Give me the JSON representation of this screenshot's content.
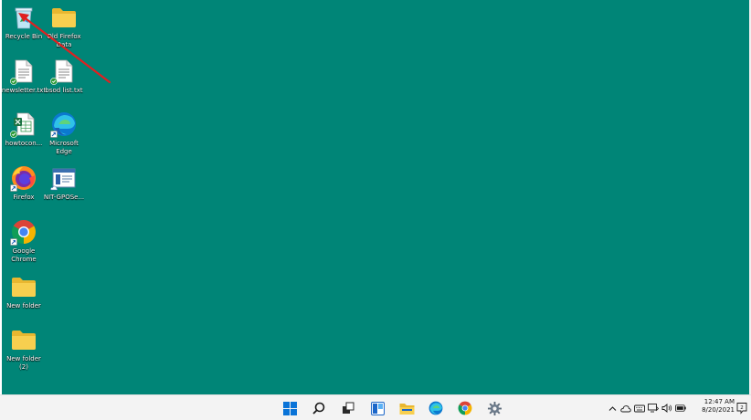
{
  "desktop": {
    "background_color": "#008577",
    "icons": [
      {
        "name": "recycle-bin",
        "label": "Recycle Bin",
        "icon": "recycle-bin-icon"
      },
      {
        "name": "old-firefox-data",
        "label": "Old Firefox\nData",
        "icon": "folder-icon"
      },
      {
        "name": "newsletter-txt",
        "label": "newsletter.txt",
        "icon": "text-file-icon"
      },
      {
        "name": "bsod-list-txt",
        "label": "bsod list.txt",
        "icon": "text-file-icon"
      },
      {
        "name": "howtocon",
        "label": "howtocon...",
        "icon": "spreadsheet-file-icon"
      },
      {
        "name": "microsoft-edge",
        "label": "Microsoft\nEdge",
        "icon": "edge-icon"
      },
      {
        "name": "firefox",
        "label": "Firefox",
        "icon": "firefox-icon"
      },
      {
        "name": "nit-gposet",
        "label": "NIT-GPOSe...",
        "icon": "app-window-icon"
      },
      {
        "name": "google-chrome",
        "label": "Google\nChrome",
        "icon": "chrome-icon"
      },
      {
        "name": "new-folder",
        "label": "New folder",
        "icon": "folder-icon"
      },
      {
        "name": "new-folder-2",
        "label": "New folder\n(2)",
        "icon": "folder-icon"
      }
    ],
    "annotation": {
      "type": "arrow",
      "color": "#e02020",
      "points_to": "recycle-bin"
    }
  },
  "taskbar": {
    "pinned": [
      {
        "name": "start",
        "icon": "windows-logo-icon"
      },
      {
        "name": "search",
        "icon": "search-icon"
      },
      {
        "name": "task-view",
        "icon": "task-view-icon"
      },
      {
        "name": "widgets",
        "icon": "widgets-icon"
      },
      {
        "name": "file-explorer",
        "icon": "folder-icon"
      },
      {
        "name": "edge",
        "icon": "edge-icon"
      },
      {
        "name": "chrome",
        "icon": "chrome-icon"
      },
      {
        "name": "settings",
        "icon": "gear-icon"
      }
    ],
    "tray": [
      "chevron-up-icon",
      "cloud-icon",
      "keyboard-icon",
      "display-icon",
      "speaker-icon",
      "battery-icon"
    ],
    "clock": {
      "time": "12:47 AM",
      "date": "8/20/2021"
    },
    "notification_icon": "notification-icon"
  }
}
